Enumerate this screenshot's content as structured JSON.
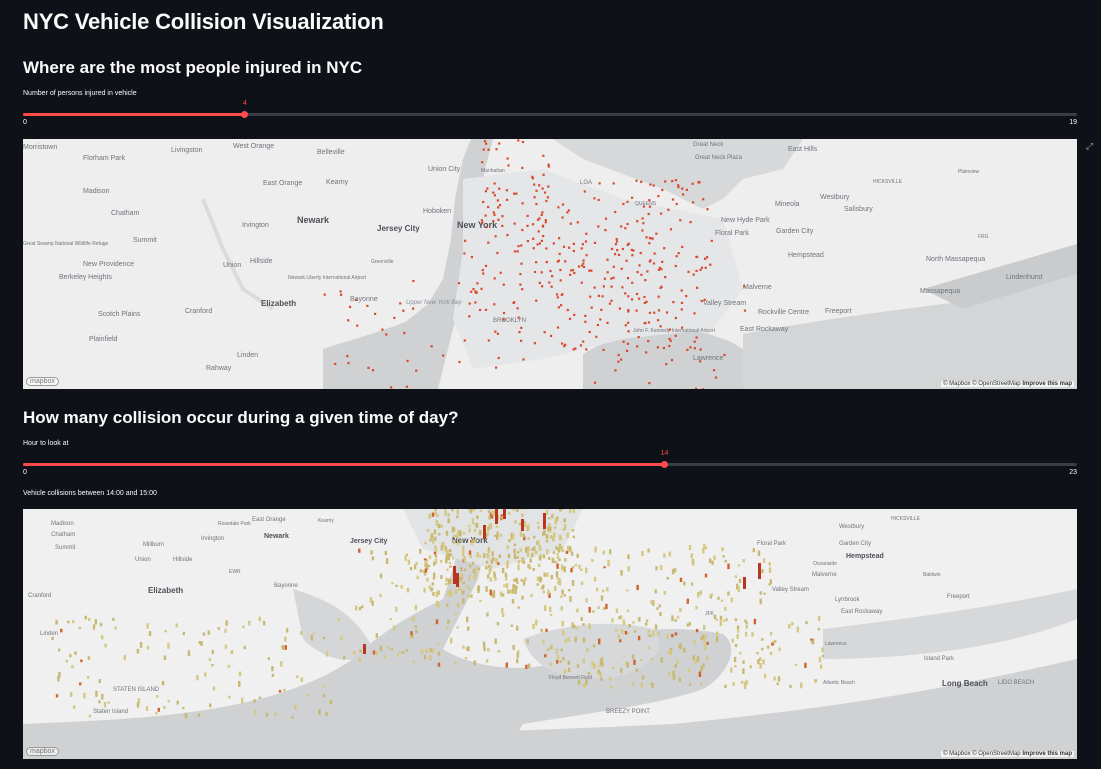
{
  "title": "NYC Vehicle Collision Visualization",
  "section1": {
    "heading": "Where are the most people injured in NYC",
    "slider": {
      "label": "Number of persons injured in vehicle",
      "value": 4,
      "min": 0,
      "max": 19
    }
  },
  "section2": {
    "heading": "How many collision occur during a given time of day?",
    "slider": {
      "label": "Hour to look at",
      "value": 14,
      "min": 0,
      "max": 23
    },
    "subheading": "Vehicle collisions between 14:00 and 15:00"
  },
  "map1": {
    "labels": [
      "Morristown",
      "Livingston",
      "West Orange",
      "Belleville",
      "Florham Park",
      "Union City",
      "Manhattan",
      "Great Neck",
      "Great Neck Plaza",
      "East Hills",
      "Madison",
      "East Orange",
      "Kearny",
      "Hoboken",
      "LGA",
      "Westbury",
      "HICKSVILLE",
      "Plainview",
      "Chatham",
      "Newark",
      "Jersey City",
      "New York",
      "QUEENS",
      "New Hyde Park",
      "Mineola",
      "Salisbury",
      "Irvington",
      "Floral Park",
      "Garden City",
      "FRG",
      "Summit",
      "Great Swamp National Wildlife Refuge",
      "New Providence",
      "Union",
      "Hillside",
      "Greenville",
      "Hempstead",
      "North Massapequa",
      "Lindenhurst",
      "Berkeley Heights",
      "Newark Liberty International Airport",
      "Bayonne",
      "Massapequa",
      "Elizabeth",
      "Upper New York Bay",
      "Malverne",
      "Valley Stream",
      "Scotch Plains",
      "Cranford",
      "BROOKLYN",
      "Rockville Centre",
      "Freeport",
      "Plainfield",
      "Linden",
      "John F. Kennedy International Airport",
      "East Rockaway",
      "Rahway",
      "Lawrence"
    ],
    "attribution": "© Mapbox © OpenStreetMap",
    "improve": "Improve this map",
    "logo": "mapbox"
  },
  "map2": {
    "labels": [
      "Madison",
      "Chatham",
      "Summit",
      "Union",
      "Cranford",
      "Rosedale Park",
      "Linden",
      "Millburn",
      "Hillside",
      "Elizabeth",
      "Irvington",
      "East Orange",
      "Newark",
      "EWR",
      "Bayonne",
      "Jersey City",
      "New York",
      "Kearny",
      "STATEN ISLAND",
      "Staten Island",
      "Floyd Bennett Field",
      "JFK",
      "Valley Stream",
      "Lynbrook",
      "Freeport",
      "Long Beach",
      "LIDO BEACH",
      "Hempstead",
      "Westbury",
      "Garden City",
      "Floral Park",
      "Malverne",
      "Baldwin",
      "Oceanside",
      "Island Park",
      "Atlantic Beach",
      "Lawrence",
      "HICKSVILLE",
      "East Rockaway",
      "BREEZY POINT"
    ],
    "attribution": "© Mapbox © OpenStreetMap",
    "improve": "Improve this map",
    "logo": "mapbox"
  }
}
